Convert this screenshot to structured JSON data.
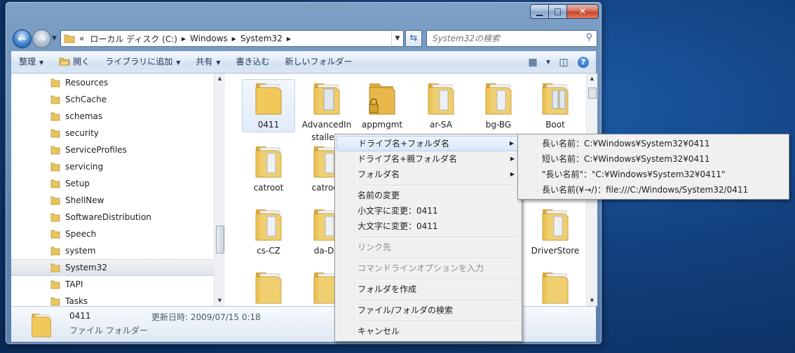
{
  "window": {
    "caption_buttons": {
      "minimize": "▁",
      "maximize": "□",
      "close": "✕"
    }
  },
  "address": {
    "prefix": "«",
    "crumbs": [
      "ローカル ディスク (C:)",
      "Windows",
      "System32"
    ],
    "search_placeholder": "System32の検索"
  },
  "toolbar": {
    "organize": "整理",
    "open": "開く",
    "add_library": "ライブラリに追加",
    "share": "共有",
    "burn": "書き込む",
    "new_folder": "新しいフォルダー"
  },
  "nav": {
    "items": [
      "Resources",
      "SchCache",
      "schemas",
      "security",
      "ServiceProfiles",
      "servicing",
      "Setup",
      "ShellNew",
      "SoftwareDistribution",
      "Speech",
      "system",
      "System32",
      "TAPI",
      "Tasks"
    ],
    "selected": "System32"
  },
  "tiles": {
    "t0411": "0411",
    "advanced": "AdvancedInstallers",
    "appmgmt": "appmgmt",
    "arsa": "ar-SA",
    "bgbg": "bg-BG",
    "boot": "Boot",
    "catroot": "catroot",
    "catroot2": "catroot",
    "cscz": "cs-CZ",
    "dadk": "da-DK",
    "driverstore": "DriverStore"
  },
  "details": {
    "name": "0411",
    "type": "ファイル フォルダー",
    "modified": "更新日時: 2009/07/15 0:18"
  },
  "context_menu": {
    "drive_folder": "ドライブ名+フォルダ名",
    "drive_parent": "ドライブ名+親フォルダ名",
    "folder_name": "フォルダ名",
    "rename": "名前の変更",
    "lowercase": "小文字に変更：0411",
    "uppercase": "大文字に変更：0411",
    "link_target": "リンク先",
    "cmdline": "コマンドラインオプションを入力",
    "create_folder": "フォルダを作成",
    "search": "ファイル/フォルダの検索",
    "cancel": "キャンセル"
  },
  "submenu": {
    "long_name": "長い名前：C:¥Windows¥System32¥0411",
    "short_name": "短い名前：C:¥Windows¥System32¥0411",
    "quoted_long": "\"長い名前\"：\"C:¥Windows¥System32¥0411\"",
    "url_long": "長い名前(¥→/)：file:///C:/Windows/System32/0411"
  }
}
